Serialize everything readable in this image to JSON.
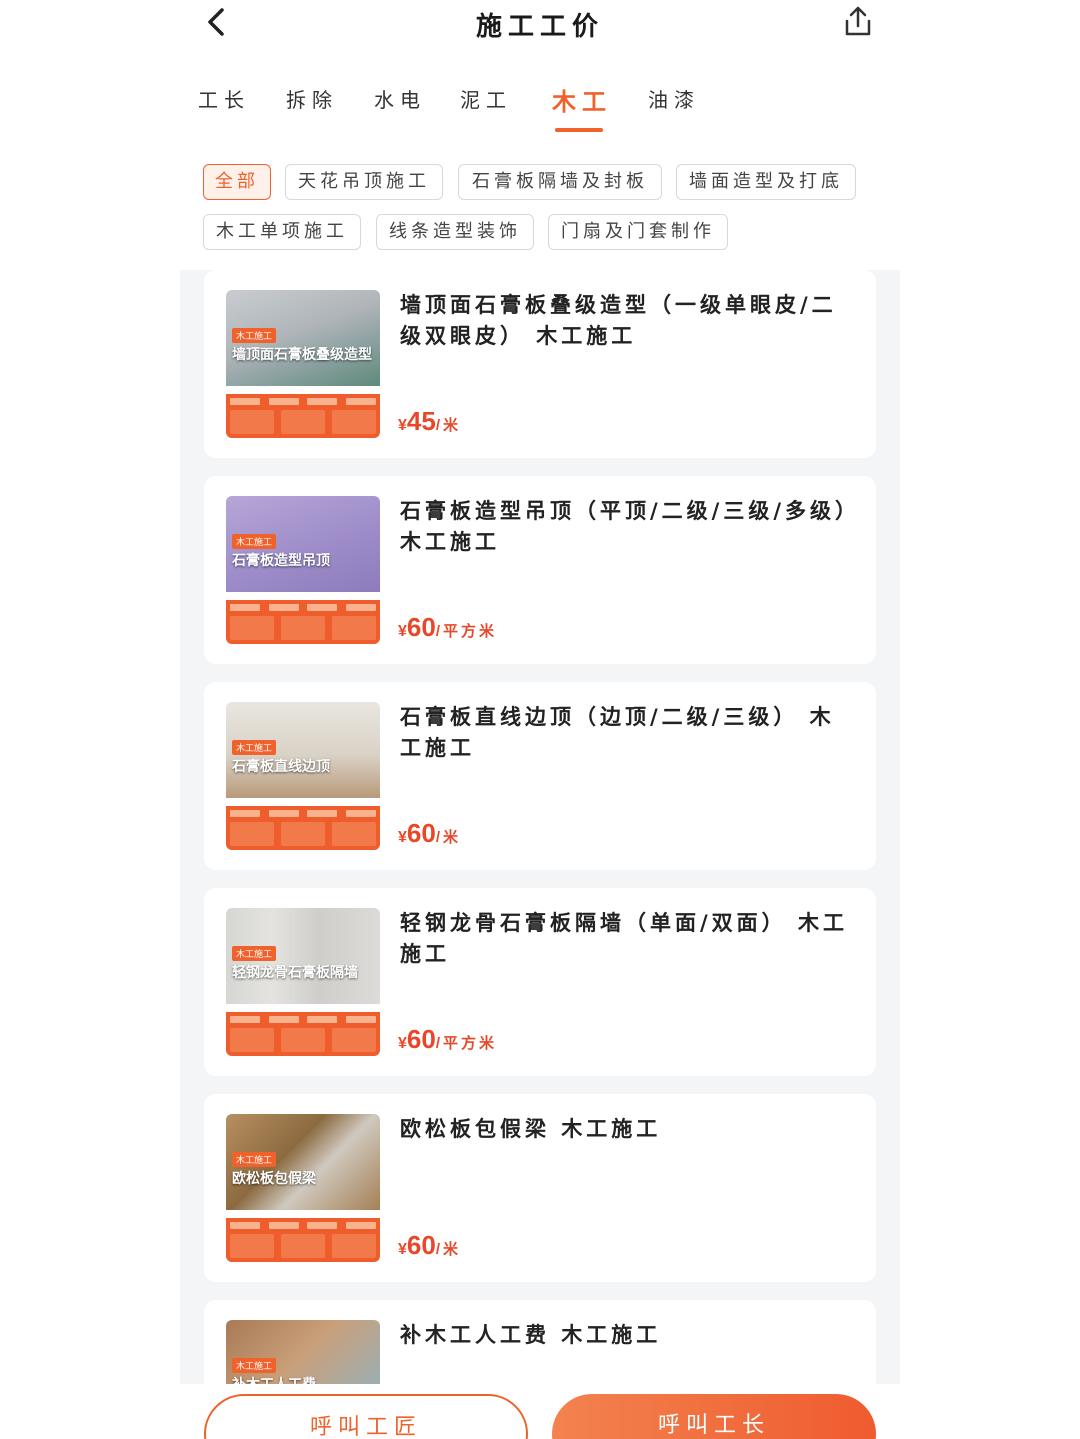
{
  "header": {
    "title": "施工工价"
  },
  "tabs": [
    {
      "label": "工长"
    },
    {
      "label": "拆除"
    },
    {
      "label": "水电"
    },
    {
      "label": "泥工"
    },
    {
      "label": "木工",
      "active": true
    },
    {
      "label": "油漆"
    }
  ],
  "chips": [
    {
      "label": "全部",
      "active": true
    },
    {
      "label": "天花吊顶施工"
    },
    {
      "label": "石膏板隔墙及封板"
    },
    {
      "label": "墙面造型及打底"
    },
    {
      "label": "木工单项施工"
    },
    {
      "label": "线条造型装饰"
    },
    {
      "label": "门扇及门套制作"
    }
  ],
  "items": [
    {
      "title": "墙顶面石膏板叠级造型（一级单眼皮/二级双眼皮） 木工施工",
      "thumb_tag": "木工施工",
      "thumb_title": "墙顶面石膏板叠级造型",
      "currency": "¥",
      "price": "45",
      "unit": "/米"
    },
    {
      "title": "石膏板造型吊顶（平顶/二级/三级/多级）　木工施工",
      "thumb_tag": "木工施工",
      "thumb_title": "石膏板造型吊顶",
      "currency": "¥",
      "price": "60",
      "unit": "/平方米"
    },
    {
      "title": "石膏板直线边顶（边顶/二级/三级） 木工施工",
      "thumb_tag": "木工施工",
      "thumb_title": "石膏板直线边顶",
      "currency": "¥",
      "price": "60",
      "unit": "/米"
    },
    {
      "title": "轻钢龙骨石膏板隔墙（单面/双面） 木工施工",
      "thumb_tag": "木工施工",
      "thumb_title": "轻钢龙骨石膏板隔墙",
      "currency": "¥",
      "price": "60",
      "unit": "/平方米"
    },
    {
      "title": "欧松板包假梁 木工施工",
      "thumb_tag": "木工施工",
      "thumb_title": "欧松板包假梁",
      "currency": "¥",
      "price": "60",
      "unit": "/米"
    },
    {
      "title": "补木工人工费 木工施工",
      "thumb_tag": "木工施工",
      "thumb_title": "补木工人工费",
      "currency": "",
      "price": "",
      "unit": ""
    }
  ],
  "footer": {
    "call_craftsman_label": "呼叫工匠",
    "call_foreman_label": "呼叫工长"
  },
  "colors": {
    "accent": "#f0622c",
    "price": "#e8482a"
  },
  "icons": {
    "back": "chevron-left-icon",
    "share": "share-icon"
  }
}
